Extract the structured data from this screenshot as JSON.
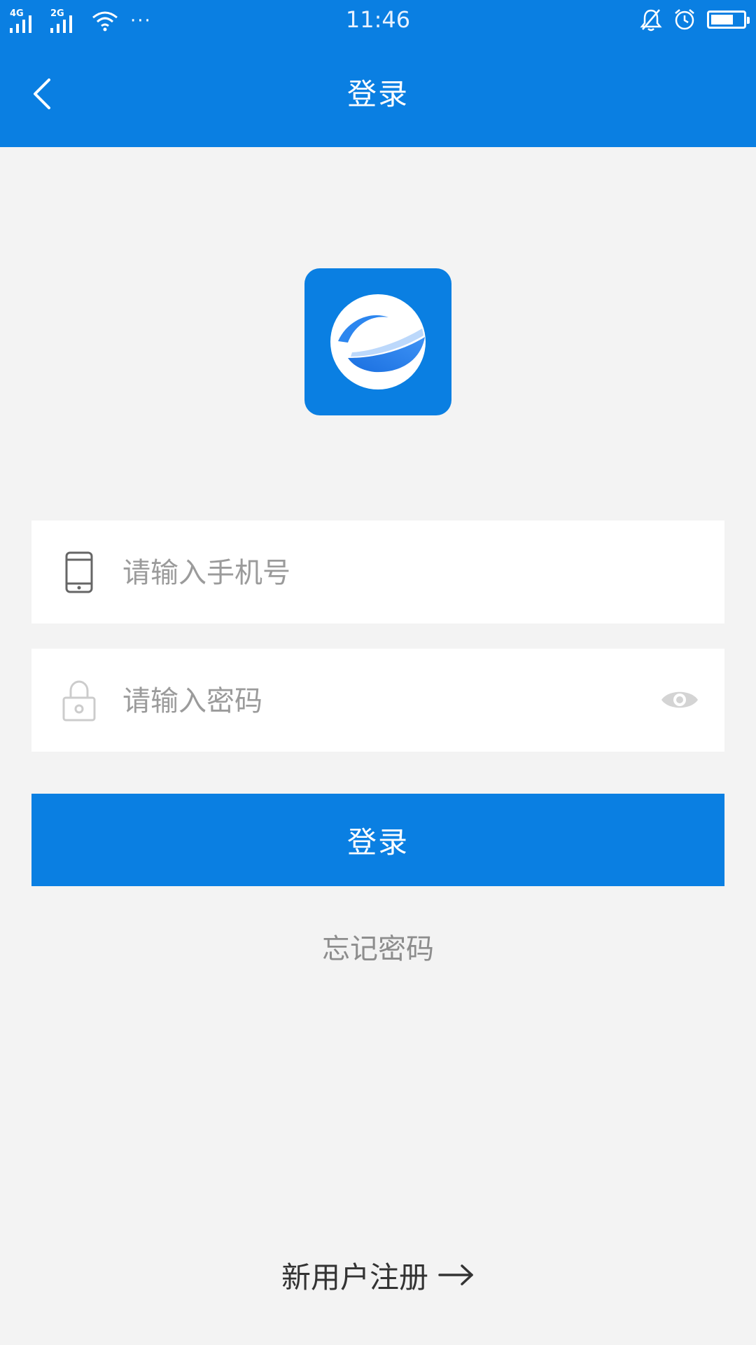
{
  "status_bar": {
    "time": "11:46",
    "network_1": "4G",
    "network_2": "2G",
    "more": "···",
    "battery_level": 0.7
  },
  "header": {
    "title": "登录",
    "back_icon": "chevron-left-icon"
  },
  "logo": {
    "icon": "app-e-logo-icon"
  },
  "form": {
    "phone": {
      "placeholder": "请输入手机号",
      "value": "",
      "icon": "phone-icon"
    },
    "password": {
      "placeholder": "请输入密码",
      "value": "",
      "icon": "lock-icon",
      "toggle_icon": "eye-icon"
    },
    "login_label": "登录",
    "forgot_label": "忘记密码"
  },
  "footer": {
    "register_label": "新用户注册",
    "arrow_icon": "arrow-right-icon"
  },
  "colors": {
    "brand": "#0a7fe2",
    "background": "#f3f3f3",
    "placeholder": "#9b9b9b"
  }
}
